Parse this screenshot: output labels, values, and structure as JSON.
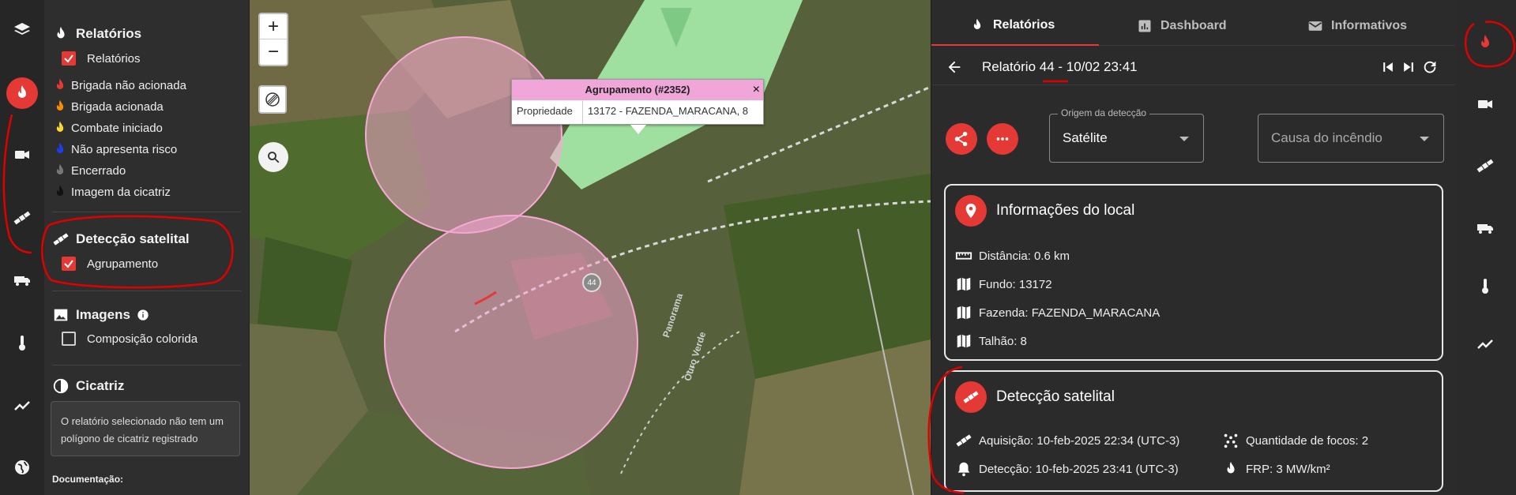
{
  "layers": {
    "reports": {
      "title": "Relatórios",
      "checkbox_label": "Relatórios",
      "checked": true
    },
    "legend": [
      {
        "label": "Brigada não acionada",
        "color": "#e53935"
      },
      {
        "label": "Brigada acionada",
        "color": "#fb8c00"
      },
      {
        "label": "Combate iniciado",
        "color": "#fdd835"
      },
      {
        "label": "Não apresenta risco",
        "color": "#1e3df0"
      },
      {
        "label": "Encerrado",
        "color": "#777777"
      },
      {
        "label": "Imagem da cicatriz",
        "color": "#111111"
      }
    ],
    "satellite": {
      "title": "Detecção satelital",
      "checkbox_label": "Agrupamento",
      "checked": true
    },
    "images": {
      "title": "Imagens",
      "checkbox_label": "Composição colorida",
      "checked": false
    },
    "scar": {
      "title": "Cicatriz",
      "note": "O relatório selecionado não tem um polígono de cicatriz registrado"
    },
    "doc_label": "Documentação:"
  },
  "map": {
    "zoom_in": "+",
    "zoom_out": "−",
    "popup": {
      "title": "Agrupamento (#2352)",
      "close": "×",
      "key": "Propriedade",
      "value": "13172 - FAZENDA_MARACANA, 8"
    },
    "marker_label": "44",
    "road_label_1": "Panorama",
    "road_label_2": "Ouro Verde"
  },
  "panel": {
    "tabs": [
      {
        "label": "Relatórios",
        "icon": "fire-icon"
      },
      {
        "label": "Dashboard",
        "icon": "chart-icon"
      },
      {
        "label": "Informativos",
        "icon": "mail-icon"
      }
    ],
    "report_prefix": "Relatório ",
    "report_id": "44",
    "report_suffix": " - 10/02 23:41",
    "origin": {
      "label": "Origem da detecção",
      "value": "Satélite"
    },
    "cause": {
      "placeholder": "Causa do incêndio"
    },
    "local": {
      "title": "Informações do local",
      "distance": "Distância: 0.6 km",
      "fundo": "Fundo: 13172",
      "fazenda": "Fazenda: FAZENDA_MARACANA",
      "talhao": "Talhão: 8"
    },
    "satellite": {
      "title": "Detecção satelital",
      "acquisition": "Aquisição: 10-feb-2025 22:34 (UTC-3)",
      "detection": "Detecção: 10-feb-2025 23:41 (UTC-3)",
      "focus_count": "Quantidade de focos: 2",
      "frp": "FRP: 3 MW/km²"
    }
  },
  "colors": {
    "accent": "#e53935",
    "popup_header": "#f0a6d8",
    "buffer": "#f4a6d0"
  }
}
